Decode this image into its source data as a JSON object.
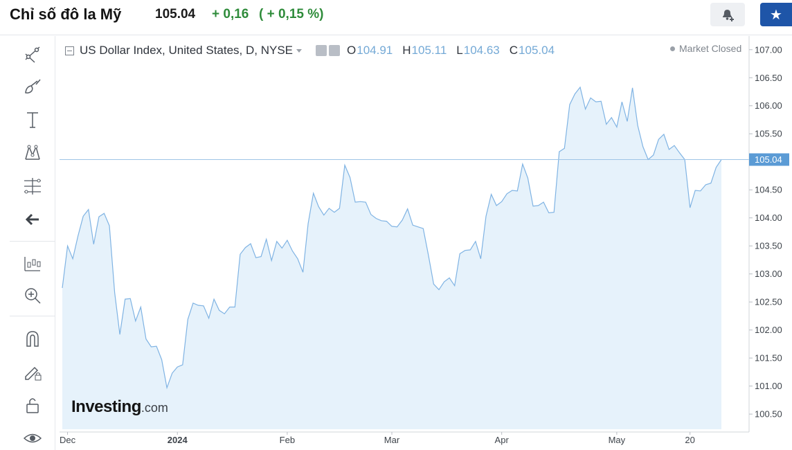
{
  "header": {
    "title": "Chỉ số đô la Mỹ",
    "price": "105.04",
    "change": "+ 0,16",
    "change_pct": "( + 0,15 %)"
  },
  "legend": {
    "symbol": "US Dollar Index, United States, D, NYSE",
    "o_label": "O",
    "o_value": "104.91",
    "h_label": "H",
    "h_value": "105.11",
    "l_label": "L",
    "l_value": "104.63",
    "c_label": "C",
    "c_value": "105.04",
    "status": "Market Closed"
  },
  "watermark": {
    "brand": "Investing",
    "domain": ".com"
  },
  "toolbar_icons": [
    "trend-line-icon",
    "brush-icon",
    "text-icon",
    "pattern-icon",
    "fib-icon",
    "back-arrow-icon",
    "indicators-icon",
    "zoom-icon",
    "magnet-icon",
    "lock-drawing-icon",
    "lock-icon",
    "eye-icon"
  ],
  "colors": {
    "line": "#7fb3e3",
    "fill": "#e6f2fb",
    "last_tag": "#5b9bd5",
    "up": "#2e8b3a",
    "star_button": "#1e55a8"
  },
  "chart_data": {
    "type": "area",
    "title": "US Dollar Index, United States, D, NYSE",
    "ylim": [
      100.23,
      107.17
    ],
    "yticks": [
      100.5,
      101.0,
      101.5,
      102.0,
      102.5,
      103.0,
      103.5,
      104.0,
      104.5,
      105.0,
      105.5,
      106.0,
      106.5,
      107.0
    ],
    "ytick_labels": [
      "100.50",
      "101.00",
      "101.50",
      "102.00",
      "102.50",
      "103.00",
      "103.50",
      "104.00",
      "104.50",
      "105.00",
      "105.50",
      "106.00",
      "106.50",
      "107.00"
    ],
    "xtick_labels": [
      "Dec",
      "2024",
      "Feb",
      "Mar",
      "Apr",
      "May",
      "20"
    ],
    "xtick_index": [
      1,
      22,
      43,
      63,
      84,
      106,
      120
    ],
    "last_value": 105.04,
    "last_label": "105.04",
    "grid": false,
    "series": [
      {
        "values": [
          102.75,
          103.5,
          103.27,
          103.68,
          104.03,
          104.15,
          103.53,
          104.02,
          104.08,
          103.86,
          102.67,
          101.92,
          102.55,
          102.56,
          102.16,
          102.41,
          101.84,
          101.7,
          101.71,
          101.47,
          100.97,
          101.23,
          101.34,
          101.38,
          102.19,
          102.48,
          102.44,
          102.43,
          102.21,
          102.55,
          102.35,
          102.29,
          102.41,
          102.41,
          103.35,
          103.47,
          103.54,
          103.29,
          103.31,
          103.62,
          103.24,
          103.58,
          103.46,
          103.6,
          103.41,
          103.27,
          103.03,
          103.9,
          104.44,
          104.2,
          104.05,
          104.17,
          104.1,
          104.17,
          104.94,
          104.72,
          104.28,
          104.29,
          104.28,
          104.06,
          103.99,
          103.95,
          103.94,
          103.85,
          103.84,
          103.96,
          104.16,
          103.87,
          103.84,
          103.81,
          103.33,
          102.82,
          102.72,
          102.86,
          102.93,
          102.79,
          103.36,
          103.42,
          103.43,
          103.58,
          103.27,
          104.03,
          104.42,
          104.22,
          104.29,
          104.43,
          104.49,
          104.48,
          104.96,
          104.71,
          104.21,
          104.22,
          104.28,
          104.09,
          104.1,
          105.18,
          105.24,
          106.02,
          106.21,
          106.33,
          105.94,
          106.14,
          106.07,
          106.08,
          105.67,
          105.79,
          105.62,
          106.07,
          105.72,
          106.32,
          105.65,
          105.27,
          105.04,
          105.12,
          105.4,
          105.49,
          105.22,
          105.29,
          105.16,
          105.04,
          104.18,
          104.49,
          104.48,
          104.59,
          104.62,
          104.9,
          105.04
        ]
      }
    ]
  }
}
